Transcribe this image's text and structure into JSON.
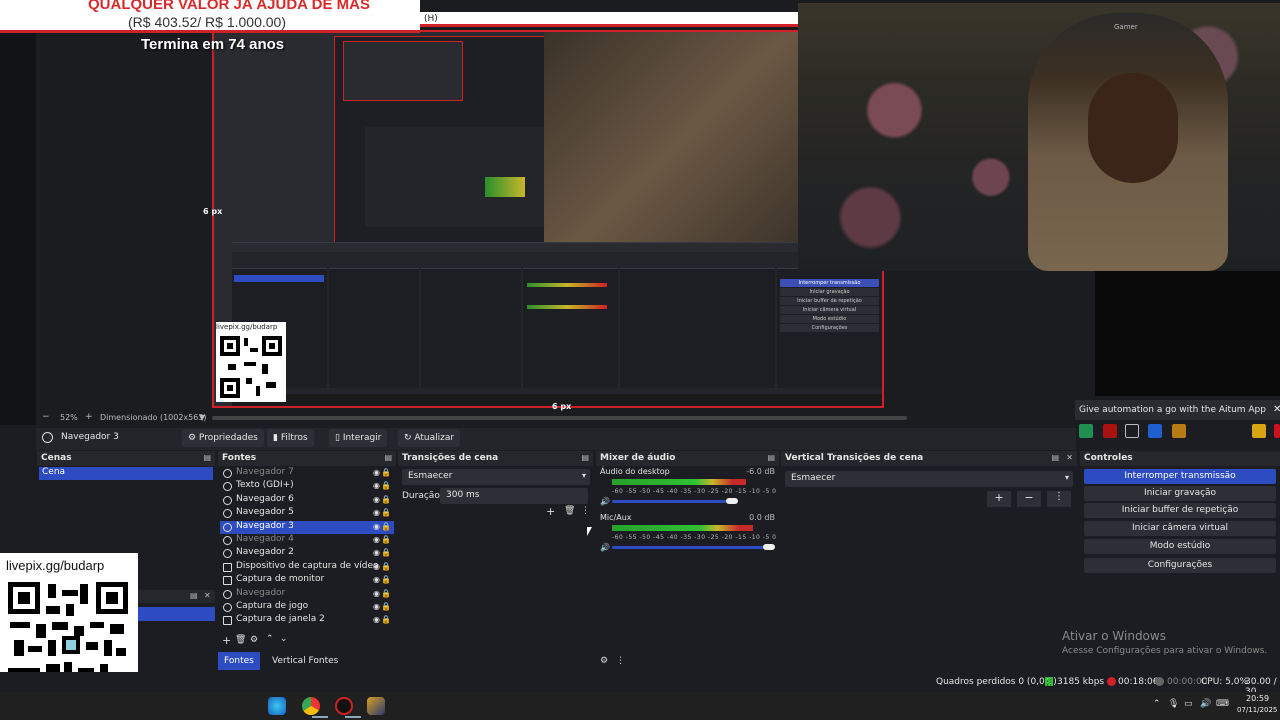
{
  "overlay": {
    "donation_line1": "QUALQUER VALOR JÁ AJUDA DE MAS",
    "donation_line2": "(R$ 403.52/ R$ 1.000.00)",
    "countdown": "Termina em 74 anos",
    "menu_h": "(H)",
    "qr_label": "livepix.gg/budarp",
    "qr_small_label": "livepix.gg/budarp",
    "chair_brand": "Gamer"
  },
  "preview": {
    "px_left": "6 px",
    "px_bottom": "6 px",
    "zoom_minus": "−",
    "zoom_value": "52%",
    "zoom_plus": "+",
    "zoom_mode": "Dimensionado (1002x563)",
    "zoom_caret": "▼"
  },
  "inner": {
    "scene_btns": [
      "Interromper transmissão",
      "Iniciar gravação",
      "Iniciar buffer de repetição",
      "Iniciar câmera virtual",
      "Modo estúdio",
      "Configurações"
    ],
    "activate": "Ativar o Windows"
  },
  "aitum": {
    "text": "Give automation a go with the Aitum App",
    "close": "✕"
  },
  "source_toolbar": {
    "source_name": "Navegador 3",
    "properties": "⚙ Propriedades",
    "filters": "▮ Filtros",
    "interact": "▯ Interagir",
    "refresh": "↻ Atualizar"
  },
  "scenes": {
    "title": "Cenas",
    "items": [
      "Cena"
    ]
  },
  "sources": {
    "title": "Fontes",
    "items": [
      {
        "label": "Navegador 7",
        "dim": true,
        "icon": "globe"
      },
      {
        "label": "Texto (GDI+)",
        "dim": false,
        "icon": "text"
      },
      {
        "label": "Navegador 6",
        "dim": false,
        "icon": "globe"
      },
      {
        "label": "Navegador 5",
        "dim": false,
        "icon": "globe"
      },
      {
        "label": "Navegador 3",
        "dim": false,
        "icon": "globe",
        "selected": true
      },
      {
        "label": "Navegador 4",
        "dim": true,
        "icon": "globe"
      },
      {
        "label": "Navegador 2",
        "dim": false,
        "icon": "globe"
      },
      {
        "label": "Dispositivo de captura de vídeo",
        "dim": false,
        "icon": "camera"
      },
      {
        "label": "Captura de monitor",
        "dim": false,
        "icon": "monitor"
      },
      {
        "label": "Navegador",
        "dim": true,
        "icon": "globe"
      },
      {
        "label": "Captura de jogo",
        "dim": false,
        "icon": "gamepad"
      },
      {
        "label": "Captura de janela 2",
        "dim": false,
        "icon": "window"
      }
    ],
    "tab_sources": "Fontes",
    "tab_vertical": "Vertical Fontes"
  },
  "transitions": {
    "title": "Transições de cena",
    "selected": "Esmaecer",
    "duration_label": "Duração",
    "duration_value": "300 ms"
  },
  "mixer": {
    "title": "Mixer de áudio",
    "channels": [
      {
        "name": "Áudio do desktop",
        "db": "-6.0 dB",
        "level": 0.82
      },
      {
        "name": "Mic/Aux",
        "db": "0.0 dB",
        "level": 0.86
      }
    ],
    "scale": "-60 -55 -50 -45 -40 -35 -30 -25 -20 -15 -10 -5 0"
  },
  "vtrans": {
    "title": "Vertical Transições de cena",
    "selected": "Esmaecer"
  },
  "controls": {
    "title": "Controles",
    "buttons": [
      "Interromper transmissão",
      "Iniciar gravação",
      "Iniciar buffer de repetição",
      "Iniciar câmera virtual",
      "Modo estúdio",
      "Configurações"
    ]
  },
  "watermark": {
    "line1": "Ativar o Windows",
    "line2": "Acesse Configurações para ativar o Windows."
  },
  "status": {
    "dropped": "Quadros perdidos 0 (0,0%)",
    "bitrate": "3185 kbps",
    "live_time": "00:18:06",
    "rec_time": "00:00:00",
    "cpu": "CPU: 5,0%",
    "fps": "30.00 / 30"
  },
  "taskbar": {
    "time": "20:59",
    "date": "07/11/2025"
  },
  "colors": {
    "accent": "#2d4cc2",
    "alert_red": "#d0202a"
  }
}
